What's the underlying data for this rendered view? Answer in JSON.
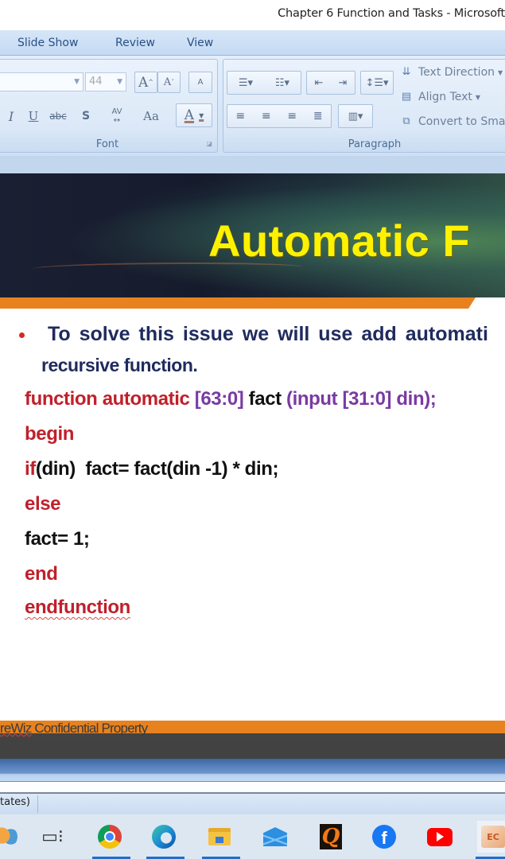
{
  "window": {
    "title": "Chapter 6  Function and Tasks - Microsoft"
  },
  "ribbon": {
    "tabs": [
      "Slide Show",
      "Review",
      "View"
    ],
    "font_group": {
      "label": "Font",
      "font_name_value": "",
      "font_size_value": "44",
      "grow_font": "A",
      "shrink_font": "A",
      "clear_formatting": "A",
      "italic": "I",
      "underline": "U",
      "strikethrough": "abc",
      "shadow": "S",
      "char_spacing": "AV",
      "change_case": "Aa",
      "font_color": "A"
    },
    "paragraph_group": {
      "label": "Paragraph",
      "text_direction": "Text Direction",
      "align_text": "Align Text",
      "convert_smartart": "Convert to Sma"
    }
  },
  "slide": {
    "title": "Automatic F",
    "bullet_line1": "To solve this issue we will use add automati",
    "bullet_line2": "recursive function.",
    "code": {
      "l1_kw": "function automatic",
      "l1_range": "[63:0]",
      "l1_name": "fact",
      "l1_args": "(input [31:0] din);",
      "l2": "begin",
      "l3_kw": "if",
      "l3_rest": "(din)  fact= fact(din -1) * din;",
      "l4": "else",
      "l5": "fact= 1;",
      "l6": "end",
      "l7": "endfunction"
    },
    "footer_prefix": "reWiz",
    "footer_suffix": " Confidential Property"
  },
  "status_bar": {
    "text": "tates)"
  },
  "taskbar": {
    "items": [
      {
        "name": "widgets",
        "active": false
      },
      {
        "name": "task-view",
        "active": false
      },
      {
        "name": "chrome",
        "active": true
      },
      {
        "name": "edge",
        "active": true
      },
      {
        "name": "file-explorer",
        "active": true
      },
      {
        "name": "mail",
        "active": false
      },
      {
        "name": "q-app",
        "active": false
      },
      {
        "name": "facebook",
        "active": false
      },
      {
        "name": "youtube",
        "active": false
      },
      {
        "name": "powerpoint",
        "active": true
      }
    ],
    "fb_glyph": "f",
    "q_glyph": "Q",
    "ppt_glyph": "EC"
  },
  "colors": {
    "slide_title": "#fff200",
    "keyword": "#c0202b",
    "bracket": "#7a3aa3",
    "accent_orange": "#e8821e",
    "bullet_text": "#1f2b5e"
  }
}
